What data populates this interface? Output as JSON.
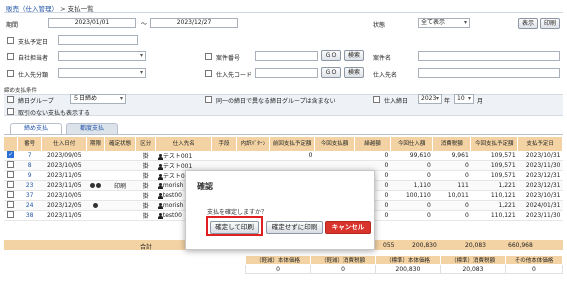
{
  "breadcrumb": {
    "parent": "販売（仕入管理）",
    "sep": ">",
    "current": "支払一覧"
  },
  "filters": {
    "period_label": "期間",
    "date_from": "2023/01/01",
    "tilde": "〜",
    "date_to": "2023/12/27",
    "status_label": "状態",
    "status_value": "全て表示",
    "display_btn": "表示",
    "print_btn": "印刷",
    "scheduled_pay_label": "支払予定日",
    "own_staff_label": "自社担当者",
    "case_no_label": "案件番号",
    "case_name_label": "案件名",
    "supplier_dept_label": "仕入先分類",
    "supplier_code_label": "仕入先コード",
    "supplier_name_label": "仕入先名",
    "go_label": "ＧＯ",
    "search_label": "検索"
  },
  "closing": {
    "section_label": "締め支払条件",
    "group_label": "締日グループ",
    "group_value": "５日締め",
    "same_group_label": "同一の締日で異なる締日グループは含まない",
    "closing_day_label": "仕入締日",
    "year_value": "2023",
    "year_unit": "年",
    "month_value": "10",
    "month_unit": "月",
    "unpaid_label": "取引のない支払も表示する"
  },
  "tabs": [
    "締め支払",
    "都度支払"
  ],
  "table": {
    "headers": [
      "番号",
      "仕入日付",
      "期限",
      "確定状態",
      "区分",
      "仕入先名",
      "手段",
      "内訳ﾊﾟﾀｰﾝ",
      "前回支払予定額",
      "今回支払額",
      "繰越額",
      "今回仕入額",
      "消費税額",
      "今回支払予定額",
      "支払予定日"
    ],
    "rows": [
      {
        "checked": true,
        "no": "7",
        "date": "2023/09/05",
        "limit": "",
        "icons": "",
        "state": "",
        "kbn": "掛",
        "name": "テスト001",
        "pm": "",
        "pat": "",
        "prev": "0",
        "paid": "",
        "carry": "0",
        "purchase": "99,610",
        "tax": "9,961",
        "sched": "109,571",
        "due": "2023/10/31"
      },
      {
        "checked": false,
        "no": "8",
        "date": "2023/10/05",
        "limit": "",
        "icons": "",
        "state": "",
        "kbn": "掛",
        "name": "テスト001",
        "pm": "",
        "pat": "",
        "prev": "",
        "paid": "",
        "carry": "0",
        "purchase": "0",
        "tax": "0",
        "sched": "109,571",
        "due": "2023/11/30"
      },
      {
        "checked": false,
        "no": "9",
        "date": "2023/11/05",
        "limit": "",
        "icons": "",
        "state": "",
        "kbn": "掛",
        "name": "テスト001",
        "pm": "",
        "pat": "",
        "prev": "",
        "paid": "",
        "carry": "0",
        "purchase": "0",
        "tax": "0",
        "sched": "109,571",
        "due": "2023/12/31"
      },
      {
        "checked": false,
        "no": "23",
        "date": "2023/11/05",
        "limit": "",
        "icons": "dots",
        "state": "印刷",
        "kbn": "掛",
        "name": "morish",
        "pm": "",
        "pat": "",
        "prev": "",
        "paid": "",
        "carry": "0",
        "purchase": "1,110",
        "tax": "111",
        "sched": "1,221",
        "due": "2023/12/31"
      },
      {
        "checked": false,
        "no": "37",
        "date": "2023/10/05",
        "limit": "",
        "icons": "",
        "state": "",
        "kbn": "掛",
        "name": "test00",
        "pm": "",
        "pat": "",
        "prev": "",
        "paid": "",
        "carry": "0",
        "purchase": "100,110",
        "tax": "10,011",
        "sched": "110,121",
        "due": "2023/10/31"
      },
      {
        "checked": false,
        "no": "24",
        "date": "2023/12/05",
        "limit": "",
        "icons": "dot",
        "state": "",
        "kbn": "掛",
        "name": "morish",
        "pm": "",
        "pat": "",
        "prev": "",
        "paid": "",
        "carry": "0",
        "purchase": "0",
        "tax": "0",
        "sched": "1,221",
        "due": "2024/01/31"
      },
      {
        "checked": false,
        "no": "38",
        "date": "2023/11/05",
        "limit": "",
        "icons": "",
        "state": "",
        "kbn": "掛",
        "name": "test00",
        "pm": "",
        "pat": "",
        "prev": "",
        "paid": "",
        "carry": "0",
        "purchase": "0",
        "tax": "0",
        "sched": "110,121",
        "due": "2023/11/30"
      }
    ],
    "total_label": "合計",
    "total_purchase": "055",
    "total_tax": "200,830",
    "total_sched": "20,083",
    "total_sched2": "660,968"
  },
  "summary": {
    "headers": [
      "（軽減）本体価格",
      "（軽減）消費税額",
      "（標準）本体価格",
      "（標準）消費税額",
      "その他本体価格"
    ],
    "values": [
      "0",
      "0",
      "200,830",
      "20,083",
      "0"
    ]
  },
  "dialog": {
    "title": "確認",
    "message": "支払を確定しますか？",
    "confirm_print": "確定して印刷",
    "print_without_confirm": "確定せずに印刷",
    "cancel": "キャンセル"
  }
}
